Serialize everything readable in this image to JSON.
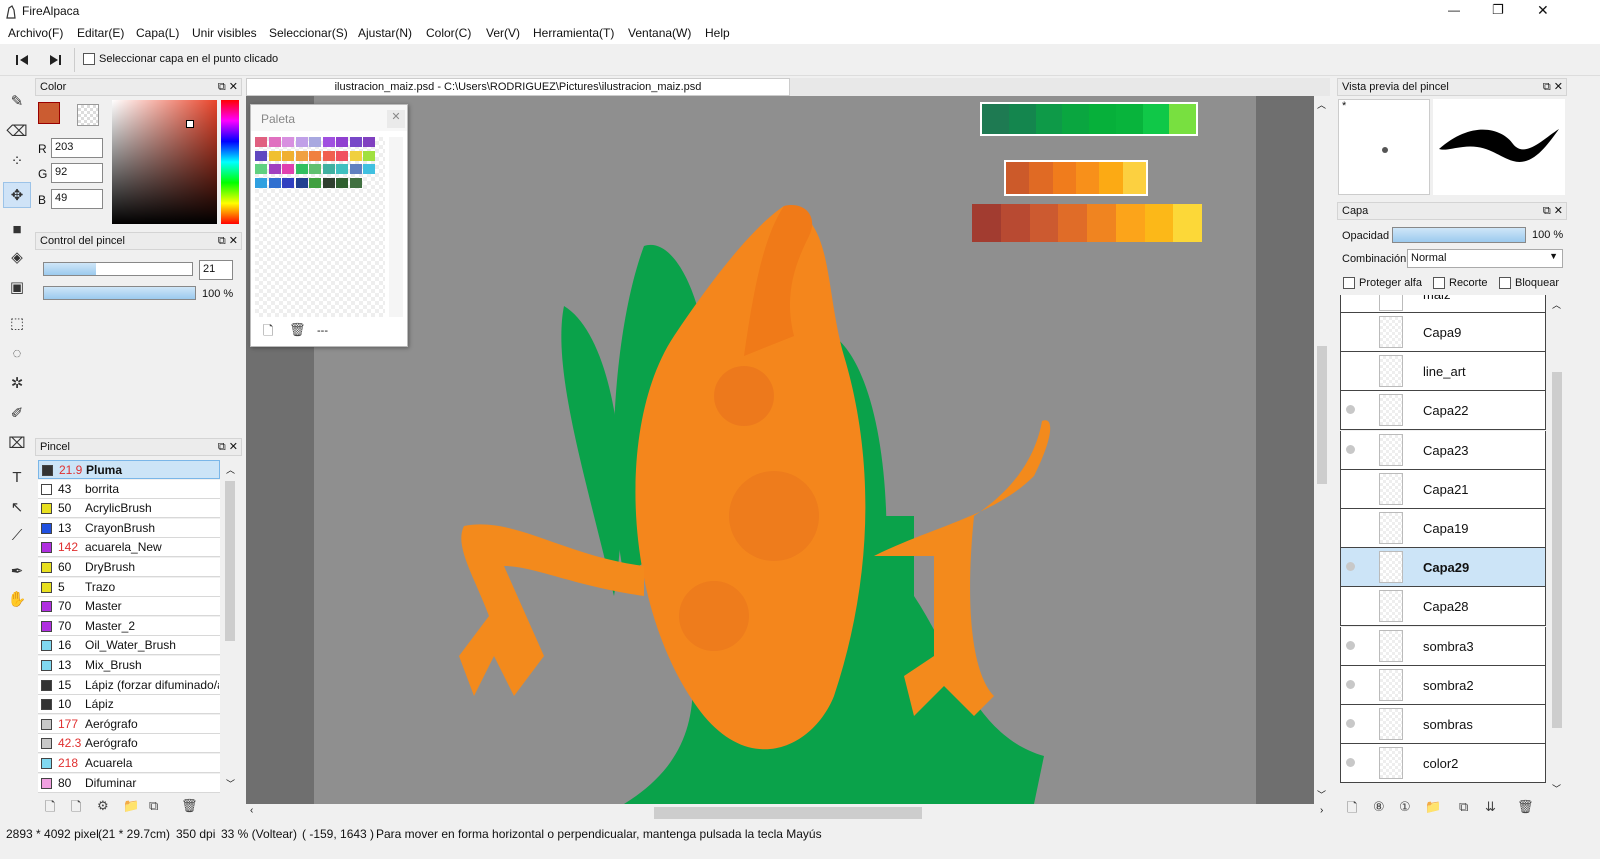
{
  "app": {
    "title": "FireAlpaca",
    "min": "—",
    "max": "❐",
    "close": "✕"
  },
  "menu": [
    "Archivo(F)",
    "Editar(E)",
    "Capa(L)",
    "Unir visibles",
    "Seleccionar(S)",
    "Ajustar(N)",
    "Color(C)",
    "Ver(V)",
    "Herramienta(T)",
    "Ventana(W)",
    "Help"
  ],
  "toolbar": {
    "select_layer_label": "Seleccionar capa en el punto clicado"
  },
  "document": {
    "tab_title": "ilustracion_maiz.psd - C:\\Users\\RODRIGUEZ\\Pictures\\ilustracion_maiz.psd"
  },
  "color_panel": {
    "title": "Color",
    "r_label": "R",
    "g_label": "G",
    "b_label": "B",
    "r": "203",
    "g": "92",
    "b": "49",
    "fg_color": "#cb5c31"
  },
  "brush_control": {
    "title": "Control del pincel",
    "size": "21",
    "opacity": "100 %",
    "size_fill": 0.35,
    "opacity_fill": 1.0
  },
  "palette": {
    "title": "Paleta",
    "dash": "---",
    "colors": [
      "#e06080",
      "#e070c0",
      "#d890e0",
      "#c0a0e8",
      "#a8a8e0",
      "#a050e0",
      "#9040d0",
      "#7848c8",
      "#8040c0",
      "#6048c0",
      "#f0c030",
      "#f0b030",
      "#f0a040",
      "#f08040",
      "#f06050",
      "#f05060",
      "#f0d040",
      "#a0e040",
      "#60d080",
      "#a040c0",
      "#e040b0",
      "#30c060",
      "#60c070",
      "#40b0a0",
      "#40c0c0",
      "#6080c0",
      "#40c0e0",
      "#30a0e0",
      "#3070d0",
      "#3040c0",
      "#204090",
      "#40a040",
      "#304030",
      "#306030",
      "#407040"
    ]
  },
  "brush_panel": {
    "title": "Pincel",
    "items": [
      {
        "size": "21.9",
        "name": "Pluma",
        "color": "#333333",
        "red": true,
        "selected": true
      },
      {
        "size": "43",
        "name": "borrita",
        "color": "#ffffff",
        "red": false
      },
      {
        "size": "50",
        "name": "AcrylicBrush",
        "color": "#e8e020",
        "red": false
      },
      {
        "size": "13",
        "name": "CrayonBrush",
        "color": "#2050e0",
        "red": false
      },
      {
        "size": "142",
        "name": "acuarela_New",
        "color": "#b030e0",
        "red": true
      },
      {
        "size": "60",
        "name": "DryBrush",
        "color": "#e8e020",
        "red": false
      },
      {
        "size": "5",
        "name": "Trazo",
        "color": "#e8e020",
        "red": false
      },
      {
        "size": "70",
        "name": "Master",
        "color": "#b030e0",
        "red": false
      },
      {
        "size": "70",
        "name": "Master_2",
        "color": "#b030e0",
        "red": false
      },
      {
        "size": "16",
        "name": "Oil_Water_Brush",
        "color": "#80d8f0",
        "red": false
      },
      {
        "size": "13",
        "name": "Mix_Brush",
        "color": "#80d8f0",
        "red": false
      },
      {
        "size": "15",
        "name": "Lápiz (forzar difuminado/a",
        "color": "#333333",
        "red": false
      },
      {
        "size": "10",
        "name": "Lápiz",
        "color": "#333333",
        "red": false
      },
      {
        "size": "177",
        "name": "Aerógrafo",
        "color": "#c8c8c8",
        "red": true
      },
      {
        "size": "42.3",
        "name": "Aerógrafo",
        "color": "#c8c8c8",
        "red": true
      },
      {
        "size": "218",
        "name": "Acuarela",
        "color": "#80d8f0",
        "red": true
      },
      {
        "size": "80",
        "name": "Difuminar",
        "color": "#f0a0e0",
        "red": false
      }
    ]
  },
  "brush_preview": {
    "title": "Vista previa del pincel",
    "star": "*"
  },
  "layer_panel": {
    "title": "Capa",
    "opacity_label": "Opacidad",
    "opacity": "100 %",
    "blend_label": "Combinación",
    "blend": "Normal",
    "protect_alpha": "Proteger alfa",
    "clip": "Recorte",
    "lock": "Bloquear",
    "partial": "maiz",
    "layers": [
      {
        "name": "Capa9",
        "eye": false,
        "selected": false
      },
      {
        "name": "line_art",
        "eye": false,
        "selected": false
      },
      {
        "name": "Capa22",
        "eye": true,
        "selected": false
      },
      {
        "name": "Capa23",
        "eye": true,
        "selected": false
      },
      {
        "name": "Capa21",
        "eye": false,
        "selected": false
      },
      {
        "name": "Capa19",
        "eye": false,
        "selected": false
      },
      {
        "name": "Capa29",
        "eye": true,
        "selected": true
      },
      {
        "name": "Capa28",
        "eye": false,
        "selected": false
      },
      {
        "name": "sombra3",
        "eye": true,
        "selected": false
      },
      {
        "name": "sombra2",
        "eye": true,
        "selected": false
      },
      {
        "name": "sombras",
        "eye": true,
        "selected": false
      },
      {
        "name": "color2",
        "eye": true,
        "selected": false
      }
    ]
  },
  "status": {
    "size": "2893 * 4092 pixel",
    "cm": "(21 * 29.7cm)",
    "dpi": "350 dpi",
    "zoom": "33 % (Voltear)",
    "coords": "( -159, 1643 )",
    "hint": "Para mover en forma horizontal o perpendicualar, mantenga pulsada la tecla Mayús"
  },
  "swatches": {
    "greens": [
      "#1e7a52",
      "#14864e",
      "#0e9a48",
      "#0aa640",
      "#06b03a",
      "#08b43c",
      "#10c848",
      "#78e040"
    ],
    "oranges1": [
      "#cc5a2a",
      "#e06a24",
      "#f07c1c",
      "#f8901a",
      "#fcaa14",
      "#fcd040"
    ],
    "oranges2": [
      "#a23c30",
      "#b84a32",
      "#cc5a30",
      "#e06c28",
      "#f08420",
      "#fca41a",
      "#fcb818",
      "#fcd838"
    ]
  }
}
